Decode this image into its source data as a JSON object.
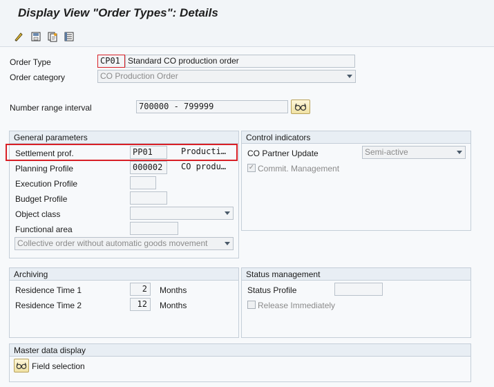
{
  "title": "Display View \"Order Types\": Details",
  "toolbar": {
    "icons": [
      "edit-icon",
      "save-icon",
      "copy-icon",
      "details-icon"
    ]
  },
  "header_fields": {
    "order_type_label": "Order Type",
    "order_type_value": "CP01",
    "order_type_desc": "Standard CO production order",
    "order_category_label": "Order category",
    "order_category_value": "CO Production Order",
    "number_range_label": "Number range interval",
    "number_range_value": "700000 - 799999"
  },
  "general": {
    "title": "General parameters",
    "settlement_label": "Settlement prof.",
    "settlement_value": "PP01",
    "settlement_desc": "Producti…",
    "planning_label": "Planning Profile",
    "planning_value": "000002",
    "planning_desc": "CO produ…",
    "execution_label": "Execution Profile",
    "budget_label": "Budget Profile",
    "object_class_label": "Object class",
    "functional_area_label": "Functional area",
    "collective_value": "Collective order without automatic goods movement"
  },
  "control": {
    "title": "Control indicators",
    "co_partner_label": "CO Partner Update",
    "co_partner_value": "Semi-active",
    "commit_label": "Commit. Management",
    "commit_checked": true,
    "check_glyph": "✓"
  },
  "archiving": {
    "title": "Archiving",
    "rt1_label": "Residence Time 1",
    "rt1_value": "2",
    "rt1_unit": "Months",
    "rt2_label": "Residence Time 2",
    "rt2_value": "12",
    "rt2_unit": "Months"
  },
  "status": {
    "title": "Status management",
    "profile_label": "Status Profile",
    "release_label": "Release Immediately"
  },
  "master": {
    "title": "Master data display",
    "field_selection_label": "Field selection"
  },
  "colors": {
    "highlight": "#d81f26",
    "group_header": "#e8eef4",
    "button": "#f0e2a4"
  }
}
